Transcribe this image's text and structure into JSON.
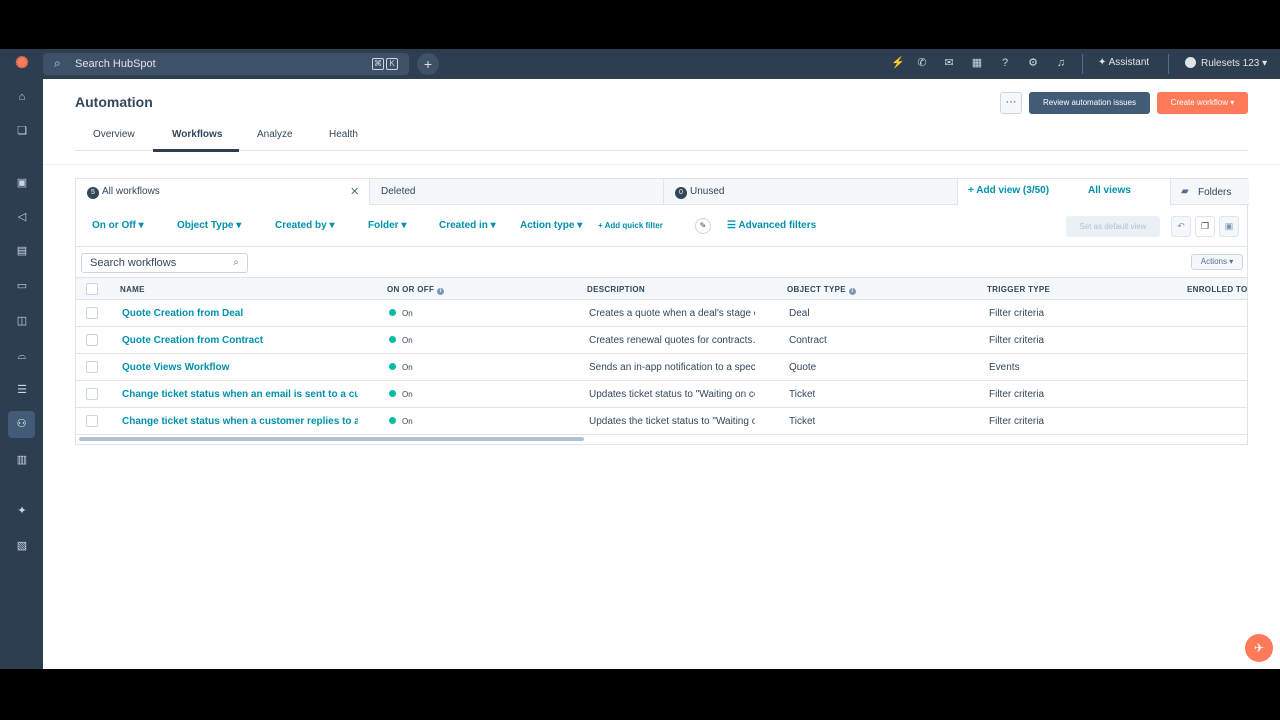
{
  "colors": {
    "nav_bg": "#2d3e50",
    "accent_orange": "#ff7a59",
    "link_teal": "#0091ae",
    "status_on": "#00bda5",
    "primary_dark": "#425b76"
  },
  "topnav": {
    "logo_icon": "hubspot-sprocket-icon",
    "search_placeholder": "Search HubSpot",
    "shortcut_keys": [
      "⌘",
      "K"
    ],
    "icons": [
      "marketplace-icon",
      "calling-icon",
      "inbox-icon",
      "marketplace-store-icon",
      "help-icon",
      "settings-icon",
      "notifications-icon"
    ],
    "assistant_label": "Assistant",
    "account_label": "Rulesets 123"
  },
  "sidebar": {
    "items": [
      "home-icon",
      "bookmarks-icon",
      "contacts-icon",
      "marketing-icon",
      "content-icon",
      "commerce-icon",
      "sales-icon",
      "service-icon",
      "data-management-icon",
      "automation-icon",
      "reporting-icon",
      "breeze-icon",
      "library-icon"
    ],
    "active_item": "automation-icon"
  },
  "header": {
    "title": "Automation",
    "more_label": "···",
    "review_label": "Review automation issues",
    "create_label": "Create workflow ▾"
  },
  "tabs": [
    {
      "label": "Overview"
    },
    {
      "label": "Workflows"
    },
    {
      "label": "Analyze"
    },
    {
      "label": "Health"
    }
  ],
  "views": {
    "all": {
      "count": "5",
      "label": "All workflows"
    },
    "deleted": {
      "label": "Deleted"
    },
    "unused": {
      "count": "0",
      "label": "Unused"
    },
    "add_view_label": "Add view (3/50)",
    "all_views_label": "All views",
    "folders_label": "Folders"
  },
  "filters": {
    "on_off": "On or Off ▾",
    "object_type": "Object Type ▾",
    "created_by": "Created by ▾",
    "folder": "Folder ▾",
    "created_in": "Created in ▾",
    "action_type": "Action type ▾",
    "add_quick_filter": "Add quick filter",
    "advanced_filters": "Advanced filters",
    "set_default_view": "Set as default view"
  },
  "table": {
    "search_placeholder": "Search workflows",
    "actions_label": "Actions ▾",
    "headers": {
      "name": "NAME",
      "on_off": "ON OR OFF",
      "description": "DESCRIPTION",
      "object_type": "OBJECT TYPE",
      "trigger_type": "TRIGGER TYPE",
      "enrolled": "ENROLLED TOTAL"
    },
    "rows": [
      {
        "name": "Quote Creation from Deal",
        "status": "On",
        "description": "Creates a quote when a deal's stage changes to…",
        "object_type": "Deal",
        "trigger_type": "Filter criteria"
      },
      {
        "name": "Quote Creation from Contract",
        "status": "On",
        "description": "Creates renewal quotes for contracts…",
        "object_type": "Contract",
        "trigger_type": "Filter criteria"
      },
      {
        "name": "Quote Views Workflow",
        "status": "On",
        "description": "Sends an in-app notification to a specific user…",
        "object_type": "Quote",
        "trigger_type": "Events"
      },
      {
        "name": "Change ticket status when an email is sent to a customer",
        "status": "On",
        "description": "Updates ticket status to \"Waiting on contact\"…",
        "object_type": "Ticket",
        "trigger_type": "Filter criteria"
      },
      {
        "name": "Change ticket status when a customer replies to an email",
        "status": "On",
        "description": "Updates the ticket status to \"Waiting on us\"…",
        "object_type": "Ticket",
        "trigger_type": "Filter criteria"
      }
    ]
  }
}
